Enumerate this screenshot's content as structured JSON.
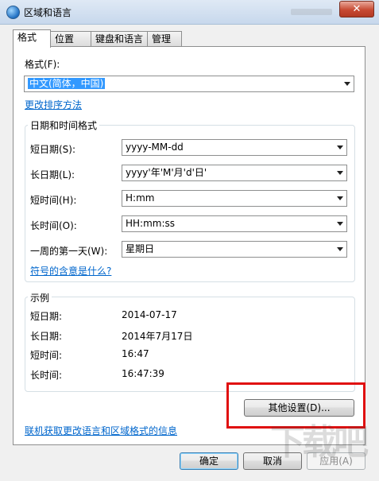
{
  "window": {
    "title": "区域和语言",
    "close_glyph": "✕"
  },
  "tabs": [
    {
      "label": "格式"
    },
    {
      "label": "位置"
    },
    {
      "label": "键盘和语言"
    },
    {
      "label": "管理"
    }
  ],
  "format": {
    "label": "格式(F):",
    "value": "中文(简体，中国)",
    "sort_link": "更改排序方法"
  },
  "datetime": {
    "group_title": "日期和时间格式",
    "rows": [
      {
        "label": "短日期(S):",
        "value": "yyyy-MM-dd"
      },
      {
        "label": "长日期(L):",
        "value": "yyyy'年'M'月'd'日'"
      },
      {
        "label": "短时间(H):",
        "value": "H:mm"
      },
      {
        "label": "长时间(O):",
        "value": "HH:mm:ss"
      },
      {
        "label": "一周的第一天(W):",
        "value": "星期日"
      }
    ],
    "symbol_link": "符号的含意是什么?"
  },
  "examples": {
    "group_title": "示例",
    "rows": [
      {
        "label": "短日期:",
        "value": "2014-07-17"
      },
      {
        "label": "长日期:",
        "value": "2014年7月17日"
      },
      {
        "label": "短时间:",
        "value": "16:47"
      },
      {
        "label": "长时间:",
        "value": "16:47:39"
      }
    ]
  },
  "other_settings_label": "其他设置(D)...",
  "online_link": "联机获取更改语言和区域格式的信息",
  "buttons": {
    "ok": "确定",
    "cancel": "取消",
    "apply": "应用(A)"
  },
  "watermark": "下载吧",
  "colors": {
    "link": "#0066cc",
    "highlight_box": "#e01010",
    "title_bar": "#c7d8ec"
  }
}
